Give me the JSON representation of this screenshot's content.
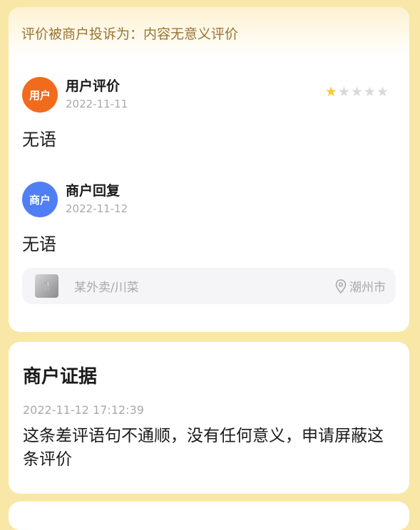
{
  "complaint": {
    "reason_label": "评价被商户投诉为：内容无意义评价"
  },
  "review": {
    "avatar_text": "用户",
    "title": "用户评价",
    "date": "2022-11-11",
    "rating": 1,
    "rating_max": 5,
    "content": "无语"
  },
  "reply": {
    "avatar_text": "商户",
    "title": "商户回复",
    "date": "2022-11-12",
    "content": "无语"
  },
  "store": {
    "name": "某外卖/川菜",
    "city": "潮州市",
    "thumb_icon": "food-thumbnail-icon"
  },
  "evidence": {
    "title": "商户证据",
    "timestamp": "2022-11-12 17:12:39",
    "text": "这条差评语句不通顺，没有任何意义，申请屏蔽这条评价"
  },
  "colors": {
    "page_bg": "#f8e7a6",
    "banner_text": "#9a7432",
    "user_avatar": "#f26b1d",
    "merchant_avatar": "#4f7ef5",
    "star_on": "#f8c73a",
    "star_off": "#d9d9d9"
  }
}
